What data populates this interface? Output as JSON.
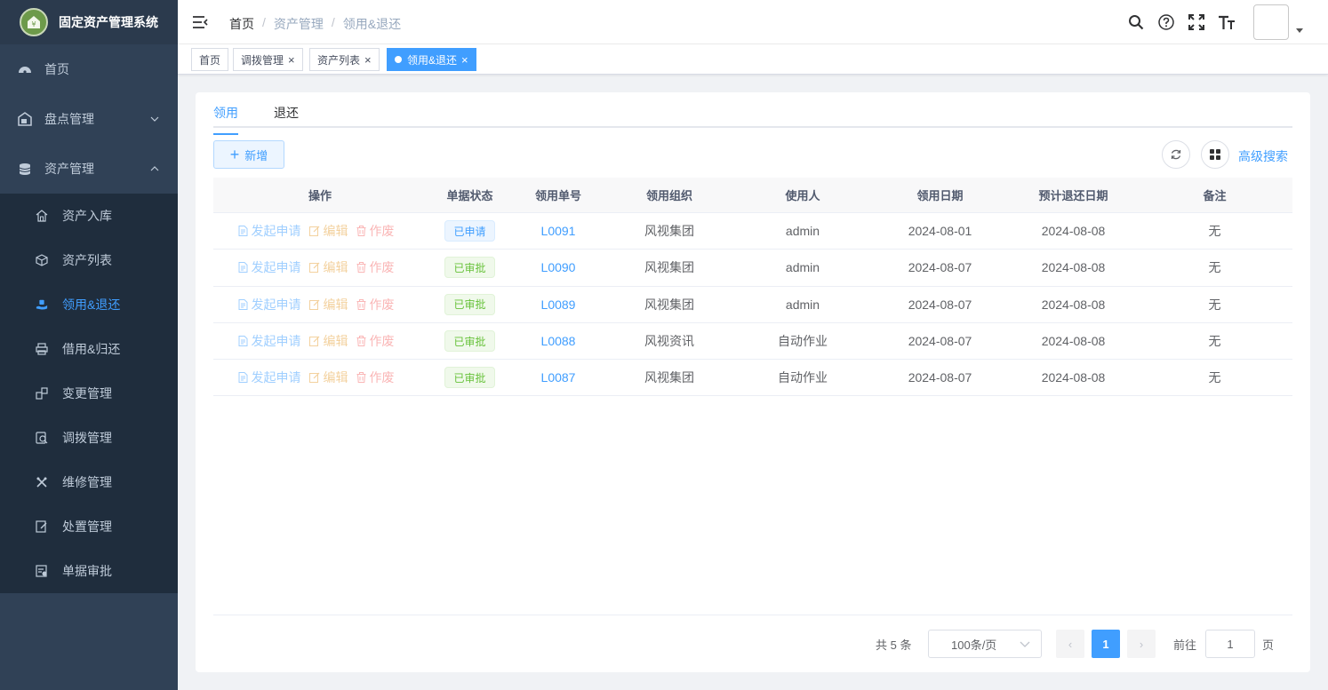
{
  "app": {
    "title": "固定资产管理系统"
  },
  "sidebar": {
    "items": [
      {
        "label": "首页",
        "icon": "dashboard-icon"
      },
      {
        "label": "盘点管理",
        "icon": "inventory-icon"
      },
      {
        "label": "资产管理",
        "icon": "database-icon"
      }
    ],
    "sub_items": [
      {
        "label": "资产入库",
        "icon": "home-icon"
      },
      {
        "label": "资产列表",
        "icon": "cube-icon"
      },
      {
        "label": "领用&退还",
        "icon": "hand-give-icon"
      },
      {
        "label": "借用&归还",
        "icon": "printer-icon"
      },
      {
        "label": "变更管理",
        "icon": "swap-icon"
      },
      {
        "label": "调拨管理",
        "icon": "transfer-icon"
      },
      {
        "label": "维修管理",
        "icon": "tools-icon"
      },
      {
        "label": "处置管理",
        "icon": "edit-doc-icon"
      },
      {
        "label": "单据审批",
        "icon": "audit-icon"
      }
    ]
  },
  "header": {
    "breadcrumb": [
      "首页",
      "资产管理",
      "领用&退还"
    ],
    "breadcrumb_sep": "/"
  },
  "tags": [
    {
      "label": "首页"
    },
    {
      "label": "调拨管理",
      "close": "×"
    },
    {
      "label": "资产列表",
      "close": "×"
    },
    {
      "label": "领用&退还",
      "close": "×"
    }
  ],
  "tabs": [
    {
      "label": "领用"
    },
    {
      "label": "退还"
    }
  ],
  "toolbar": {
    "add_label": "新增",
    "add_icon": "+",
    "advanced_search": "高级搜索"
  },
  "table": {
    "columns": [
      "操作",
      "单据状态",
      "领用单号",
      "领用组织",
      "使用人",
      "领用日期",
      "预计退还日期",
      "备注"
    ],
    "actions": {
      "apply": "发起申请",
      "edit": "编辑",
      "void": "作废"
    },
    "rows": [
      {
        "status": "已申请",
        "no": "L0091",
        "org": "风视集团",
        "user": "admin",
        "date": "2024-08-01",
        "return_date": "2024-08-08",
        "remark": "无"
      },
      {
        "status": "已审批",
        "no": "L0090",
        "org": "风视集团",
        "user": "admin",
        "date": "2024-08-07",
        "return_date": "2024-08-08",
        "remark": "无"
      },
      {
        "status": "已审批",
        "no": "L0089",
        "org": "风视集团",
        "user": "admin",
        "date": "2024-08-07",
        "return_date": "2024-08-08",
        "remark": "无"
      },
      {
        "status": "已审批",
        "no": "L0088",
        "org": "风视资讯",
        "user": "自动作业",
        "date": "2024-08-07",
        "return_date": "2024-08-08",
        "remark": "无"
      },
      {
        "status": "已审批",
        "no": "L0087",
        "org": "风视集团",
        "user": "自动作业",
        "date": "2024-08-07",
        "return_date": "2024-08-08",
        "remark": "无"
      }
    ]
  },
  "pagination": {
    "total": "共 5 条",
    "page_size": "100条/页",
    "prev": "‹",
    "current": "1",
    "next": "›",
    "goto_prefix": "前往",
    "goto_value": "1",
    "goto_suffix": "页"
  },
  "colors": {
    "primary": "#409eff",
    "sidebar": "#304156",
    "submenu": "#1f2d3d",
    "approved": "#67c23a"
  }
}
